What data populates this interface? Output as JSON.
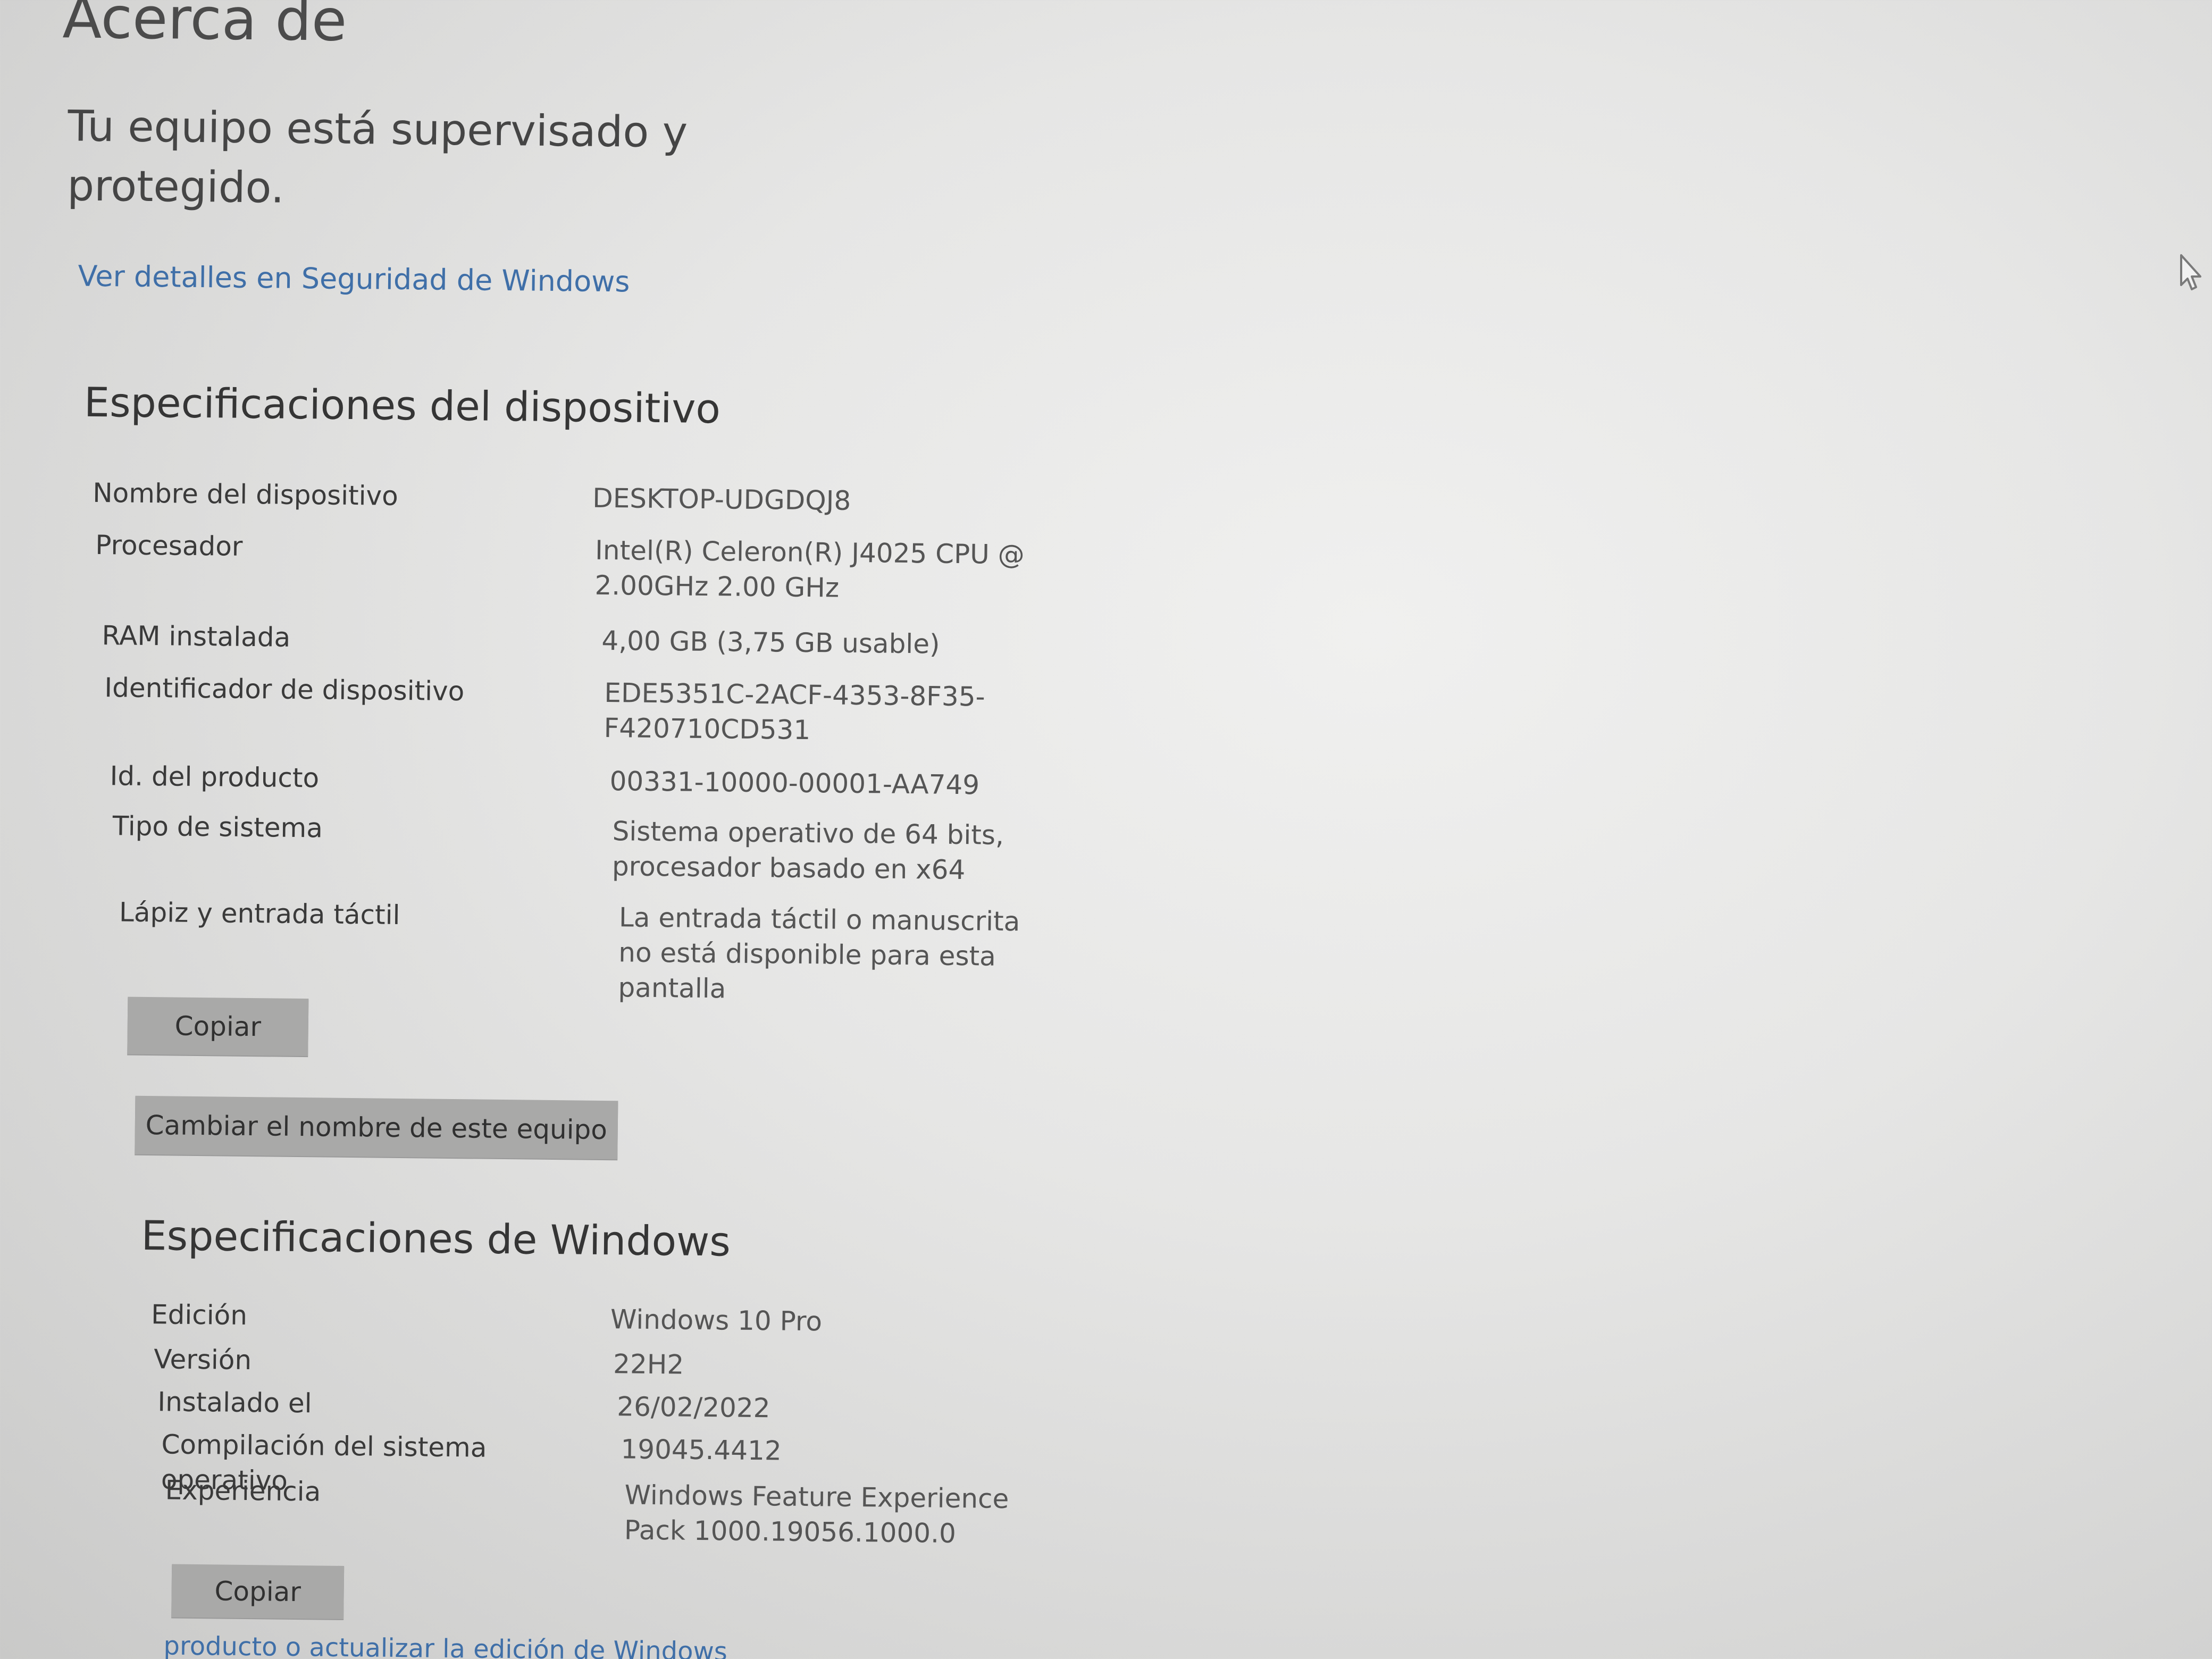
{
  "page": {
    "title": "Acerca de"
  },
  "security": {
    "status_text": "Tu equipo está supervisado y protegido.",
    "details_link": "Ver detalles en Seguridad de Windows"
  },
  "device_specs": {
    "heading": "Especificaciones del dispositivo",
    "rows": [
      {
        "label": "Nombre del dispositivo",
        "value": "DESKTOP-UDGDQJ8"
      },
      {
        "label": "Procesador",
        "value": "Intel(R) Celeron(R) J4025 CPU @ 2.00GHz   2.00 GHz"
      },
      {
        "label": "RAM instalada",
        "value": "4,00 GB (3,75 GB usable)"
      },
      {
        "label": "Identificador de dispositivo",
        "value": "EDE5351C-2ACF-4353-8F35-F420710CD531"
      },
      {
        "label": "Id. del producto",
        "value": "00331-10000-00001-AA749"
      },
      {
        "label": "Tipo de sistema",
        "value": "Sistema operativo de 64 bits, procesador basado en x64"
      },
      {
        "label": "Lápiz y entrada táctil",
        "value": "La entrada táctil o manuscrita no está disponible para esta pantalla"
      }
    ],
    "copy_button": "Copiar",
    "rename_button": "Cambiar el nombre de este equipo"
  },
  "windows_specs": {
    "heading": "Especificaciones de Windows",
    "rows": [
      {
        "label": "Edición",
        "value": "Windows 10 Pro"
      },
      {
        "label": "Versión",
        "value": "22H2"
      },
      {
        "label": "Instalado el",
        "value": "26/02/2022"
      },
      {
        "label": "Compilación del sistema operativo",
        "value": "19045.4412"
      },
      {
        "label": "Experiencia",
        "value": "Windows Feature Experience Pack 1000.19056.1000.0"
      }
    ],
    "copy_button": "Copiar",
    "upgrade_link": "producto o actualizar la edición de Windows"
  },
  "icons": {
    "cursor": "mouse-pointer-icon"
  }
}
